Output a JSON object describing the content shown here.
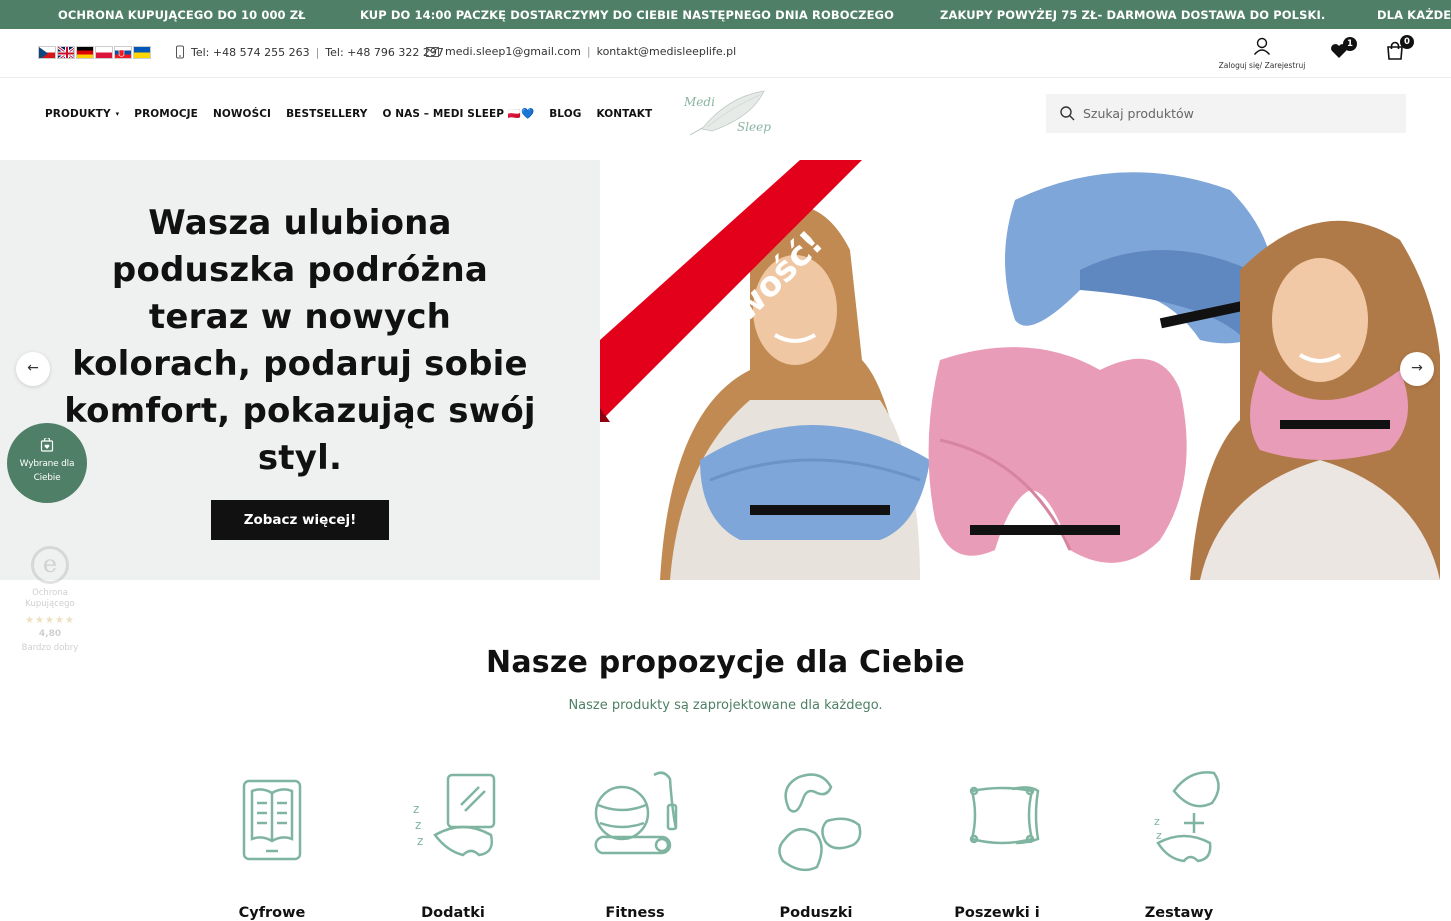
{
  "announcement": {
    "messages": [
      "OCHRONA KUPUJĄCEGO DO 10 000 ZŁ",
      "KUP DO 14:00 PACZKĘ DOSTARCZYMY DO CIEBIE NASTĘPNEGO DNIA ROBOCZEGO",
      "ZAKUPY POWYŻEJ 75 ZŁ- DARMOWA DOSTAWA DO POLSKI.",
      "DLA KAŻDE"
    ]
  },
  "contact": {
    "languages": [
      "cs",
      "en",
      "de",
      "pl",
      "sk",
      "uk"
    ],
    "phone1": "Tel: +48 574 255 263",
    "phone2": "Tel: +48 796 322 297",
    "email1": "medi.sleep1@gmail.com",
    "email2": "kontakt@medisleeplife.pl",
    "separator": "|"
  },
  "account": {
    "label": "Zaloguj się/ Zarejestruj"
  },
  "wishlist": {
    "count": "1"
  },
  "cart": {
    "count": "0"
  },
  "nav": {
    "items": [
      "PRODUKTY",
      "PROMOCJE",
      "NOWOŚCI",
      "BESTSELLERY",
      "O NAS – MEDI SLEEP 🇵🇱💙",
      "BLOG",
      "KONTAKT"
    ],
    "dropdown_caret": "▾"
  },
  "logo": {
    "line1": "Medi",
    "line2": "Sleep"
  },
  "search": {
    "placeholder": "Szukaj produktów"
  },
  "hero": {
    "title": "Wasza ulubiona poduszka podróżna teraz w nowych kolorach, podaruj sobie komfort, pokazując swój styl.",
    "button": "Zobacz więcej!",
    "ribbon": "Nowość!",
    "arrow_left": "←",
    "arrow_right": "→"
  },
  "picked_for_you": {
    "label": "Wybrane dla Ciebie"
  },
  "trust_badge": {
    "letter": "e",
    "label": "Ochrona Kupującego",
    "stars": "★★★★★",
    "score": "4,80",
    "rating_text": "Bardzo dobry"
  },
  "section": {
    "title": "Nasze propozycje dla Ciebie",
    "subtitle": "Nasze produkty są zaprojektowane dla każdego."
  },
  "categories": [
    {
      "name": "Cyfrowe",
      "icon": "book-tablet-icon"
    },
    {
      "name": "Dodatki",
      "icon": "sleep-mask-icon"
    },
    {
      "name": "Fitness",
      "icon": "fitness-ball-icon"
    },
    {
      "name": "Poduszki",
      "icon": "pillows-icon"
    },
    {
      "name": "Poszewki i",
      "icon": "pillowcase-icon"
    },
    {
      "name": "Zestawy",
      "icon": "set-icon"
    }
  ],
  "colors": {
    "brand_green": "#4f7f66",
    "icon_green": "#7fb5a0",
    "hero_bg": "#eef1ef",
    "ribbon_red": "#e2001a",
    "pillow_blue": "#7fa6d8",
    "pillow_pink": "#e99cb8"
  }
}
